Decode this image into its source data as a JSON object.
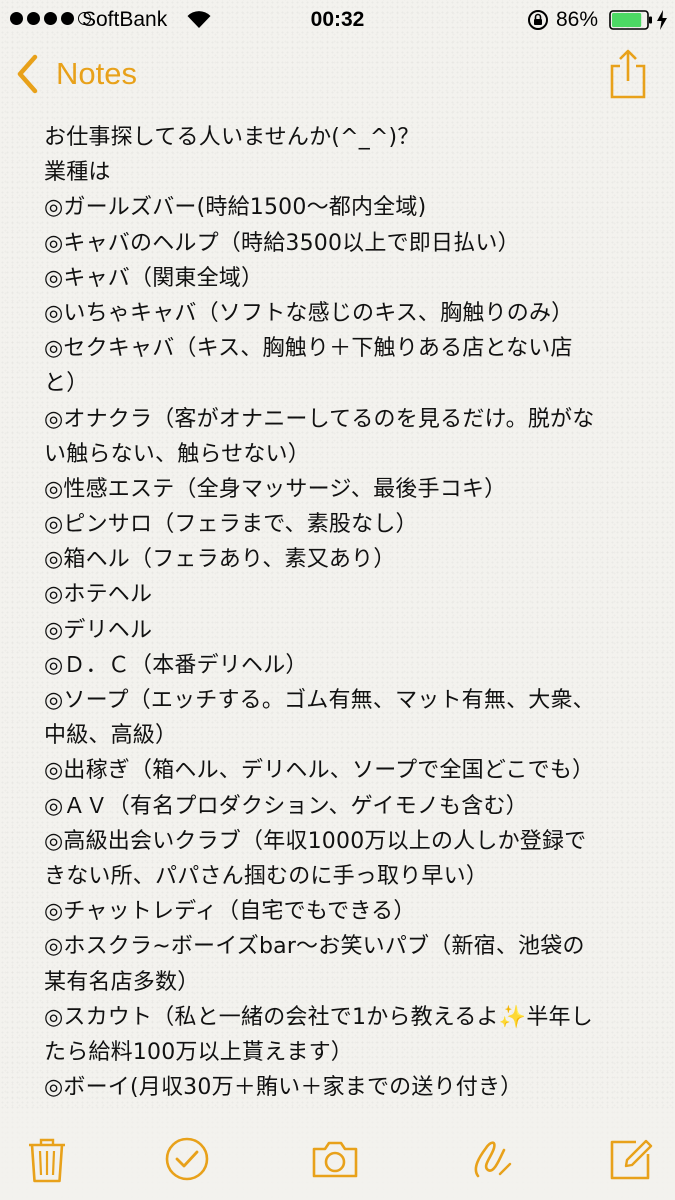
{
  "status_bar": {
    "carrier": "SoftBank",
    "time": "00:32",
    "battery_percent": "86%",
    "battery_level": 0.86,
    "signal_bars_filled": 4,
    "signal_bars_total": 5
  },
  "nav": {
    "back_label": "Notes",
    "accent_color": "#e8a11a"
  },
  "note": {
    "lines": [
      "お仕事探してる人いませんか(^_^)？",
      "業種は",
      "◎ガールズバー(時給1500〜都内全域)",
      "◎キャバのヘルプ（時給3500以上で即日払い）",
      "◎キャバ（関東全域）",
      "◎いちゃキャバ（ソフトな感じのキス、胸触りのみ）",
      "◎セクキャバ（キス、胸触り＋下触りある店とない店",
      "と）",
      "◎オナクラ（客がオナニーしてるのを見るだけ。脱がな",
      "い触らない、触らせない）",
      "◎性感エステ（全身マッサージ、最後手コキ）",
      "◎ピンサロ（フェラまで、素股なし）",
      "◎箱ヘル（フェラあり、素又あり）",
      "◎ホテヘル",
      "◎デリヘル",
      "◎Ｄ．Ｃ（本番デリヘル）",
      "◎ソープ（エッチする。ゴム有無、マット有無、大衆、",
      "中級、高級）",
      "◎出稼ぎ（箱ヘル、デリヘル、ソープで全国どこでも）",
      "◎ＡＶ（有名プロダクション、ゲイモノも含む）",
      "◎高級出会いクラブ（年収1000万以上の人しか登録で",
      "きない所、パパさん掴むのに手っ取り早い）",
      "◎チャットレディ（自宅でもできる）",
      "◎ホスクラ~ボーイズbar〜お笑いパブ（新宿、池袋の",
      "某有名店多数）",
      "◎スカウト（私と一緒の会社で1から教えるよ✨半年し",
      "たら給料100万以上貰えます）",
      "◎ボーイ(月収30万＋賄い＋家までの送り付き）"
    ]
  },
  "toolbar": {
    "icons": [
      "trash-icon",
      "checklist-icon",
      "camera-icon",
      "sketch-icon",
      "compose-icon"
    ]
  }
}
